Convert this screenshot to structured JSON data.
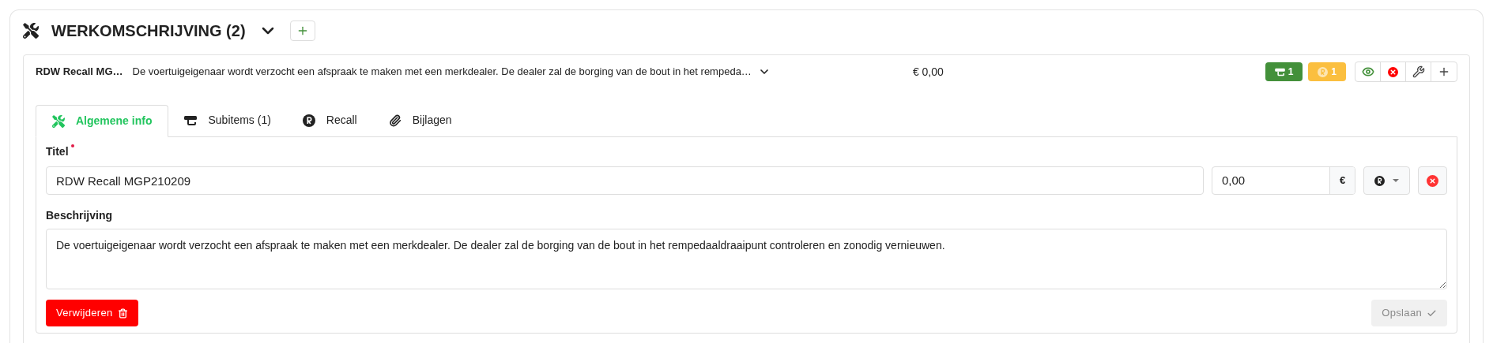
{
  "section": {
    "title": "WERKOMSCHRIJVING (2)",
    "expanded": true
  },
  "item": {
    "title": "RDW Recall MG…",
    "description": "De voertuigeigenaar wordt verzocht een afspraak te maken met een merkdealer. De dealer zal de borging van de bout in het rempeda…",
    "price": "€ 0,00",
    "expanded": true,
    "badges": [
      {
        "kind": "subitems",
        "count": "1",
        "color": "#43903a"
      },
      {
        "kind": "recall",
        "count": "1",
        "color": "#fbbf3f"
      }
    ]
  },
  "tabs": [
    {
      "kind": "tools",
      "label": "Algemene info",
      "selected": true
    },
    {
      "kind": "subitems",
      "label": "Subitems (1)",
      "selected": false
    },
    {
      "kind": "recall",
      "label": "Recall",
      "selected": false
    },
    {
      "kind": "attachments",
      "label": "Bijlagen",
      "selected": false
    }
  ],
  "form": {
    "title_label": "Titel",
    "title_required": true,
    "title_value": "RDW Recall MGP210209",
    "amount_value": "0,00",
    "currency": "€",
    "description_label": "Beschrijving",
    "description_value": "De voertuigeigenaar wordt verzocht een afspraak te maken met een merkdealer. De dealer zal de borging van de bout in het rempedaaldraaipunt controleren en zonodig vernieuwen.",
    "delete_label": "Verwijderen",
    "save_label": "Opslaan",
    "save_disabled": true
  }
}
